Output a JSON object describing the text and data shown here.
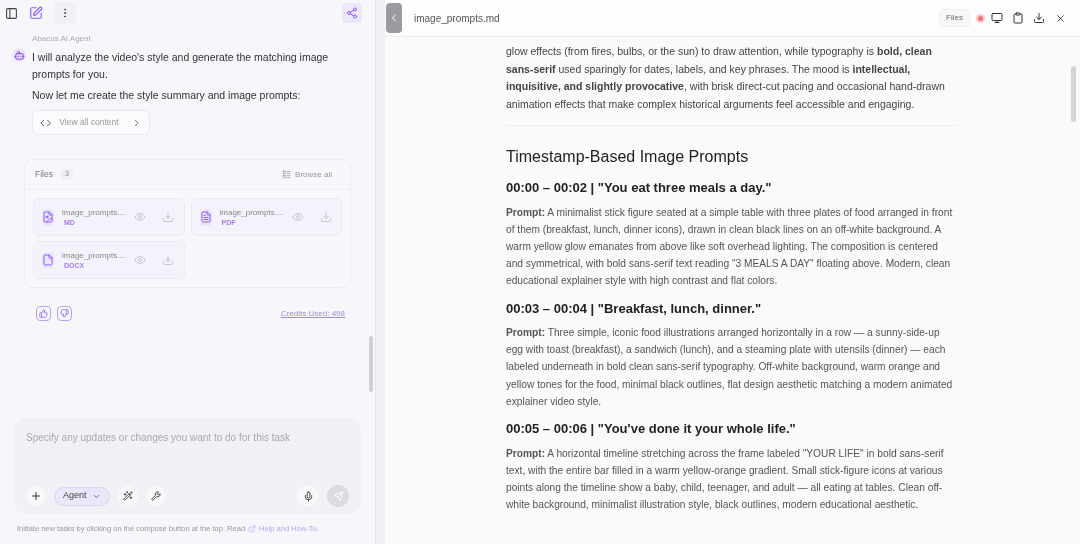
{
  "message": {
    "sender": "Abacus AI Agent",
    "paragraphs": [
      "I will analyze the video's style and generate the matching image prompts for you.",
      "Now let me create the style summary and image prompts:"
    ],
    "view_button": "View all content"
  },
  "files": {
    "title": "Files",
    "count": "3",
    "browse": "Browse all",
    "items": [
      {
        "name": "image_prompts....",
        "type": "MD",
        "kind": "md"
      },
      {
        "name": "image_prompts....",
        "type": "PDF",
        "kind": "pdf"
      },
      {
        "name": "image_prompts....",
        "type": "DOCX",
        "kind": "docx"
      }
    ]
  },
  "credits": "Credits Used: 498",
  "composer": {
    "placeholder": "Specify any updates or changes you want to do for this task",
    "mode": "Agent",
    "footer_text": "Initiate new tasks by clicking on the compose button at the top. Read",
    "footer_link": "Help and How-To."
  },
  "document": {
    "title": "image_prompts.md",
    "files_button": "Files",
    "intro": "glow effects (from fires, bulbs, or the sun) to draw attention, while typography is **bold, clean sans-serif** used sparingly for dates, labels, and key phrases. The mood is **intellectual, inquisitive, and slightly provocative**, with brisk direct-cut pacing and occasional hand-drawn animation effects that make complex historical arguments feel accessible and engaging.",
    "heading": "Timestamp-Based Image Prompts",
    "sections": [
      {
        "heading": "00:00 – 00:02 | \"You eat three meals a day.\"",
        "text": "**Prompt:** A minimalist stick figure seated at a simple table with three plates of food arranged in front of them (breakfast, lunch, dinner icons), drawn in clean black lines on an off-white background. A warm yellow glow emanates from above like soft overhead lighting. The composition is centered and symmetrical, with bold sans-serif text reading \"3 MEALS A DAY\" floating above. Modern, clean educational explainer style with high contrast and flat colors."
      },
      {
        "heading": "00:03 – 00:04 | \"Breakfast, lunch, dinner.\"",
        "text": "**Prompt:** Three simple, iconic food illustrations arranged horizontally in a row — a sunny-side-up egg with toast (breakfast), a sandwich (lunch), and a steaming plate with utensils (dinner) — each labeled underneath in bold clean sans-serif typography. Off-white background, warm orange and yellow tones for the food, minimal black outlines, flat design aesthetic matching a modern animated explainer video style."
      },
      {
        "heading": "00:05 – 00:06 | \"You've done it your whole life.\"",
        "text": "**Prompt:** A horizontal timeline stretching across the frame labeled \"YOUR LIFE\" in bold sans-serif text, with the entire bar filled in a warm yellow-orange gradient. Small stick-figure icons at various points along the timeline show a baby, child, teenager, and adult — all eating at tables. Clean off-white background, minimalist illustration style, black outlines, modern educational aesthetic."
      }
    ]
  }
}
